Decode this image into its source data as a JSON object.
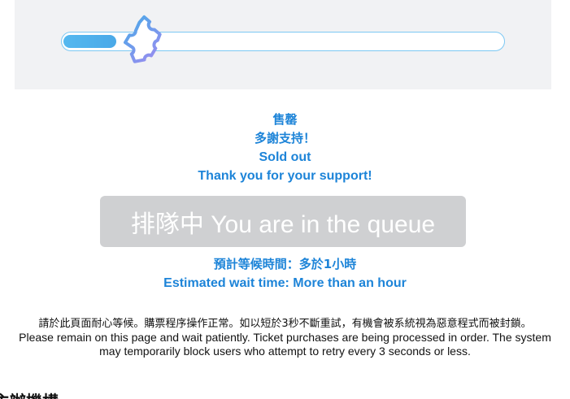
{
  "progress": {
    "fraction": 0.12
  },
  "icons": {
    "progress_marker": "ticket-icon"
  },
  "status": {
    "sold_out_zh": "售罄",
    "thanks_zh": "多謝支持！",
    "sold_out_en": "Sold out",
    "thanks_en": "Thank you for your support!"
  },
  "queue_button": {
    "label": "排隊中 You are in the queue"
  },
  "wait": {
    "label_zh": "預計等候時間：多於1小時",
    "label_en": "Estimated wait time: More than an hour"
  },
  "notice": {
    "zh": "請於此頁面耐心等候。購票程序操作正常。如以短於3秒不斷重試，有機會被系統視為惡意程式而被封鎖。",
    "en": "Please remain on this page and wait patiently. Ticket purchases are being processed in order. The system may temporarily block users who attempt to retry every 3 seconds or less."
  },
  "cut_heading": "主辦機構",
  "colors": {
    "accent_blue": "#1d84d8",
    "progress_fill": "#4aa9e8",
    "ticket_gradient_start": "#4aa9e8",
    "ticket_gradient_end": "#9c8cf0",
    "button_disabled": "#cfd0d2",
    "panel_bg": "#f1f2f4"
  }
}
